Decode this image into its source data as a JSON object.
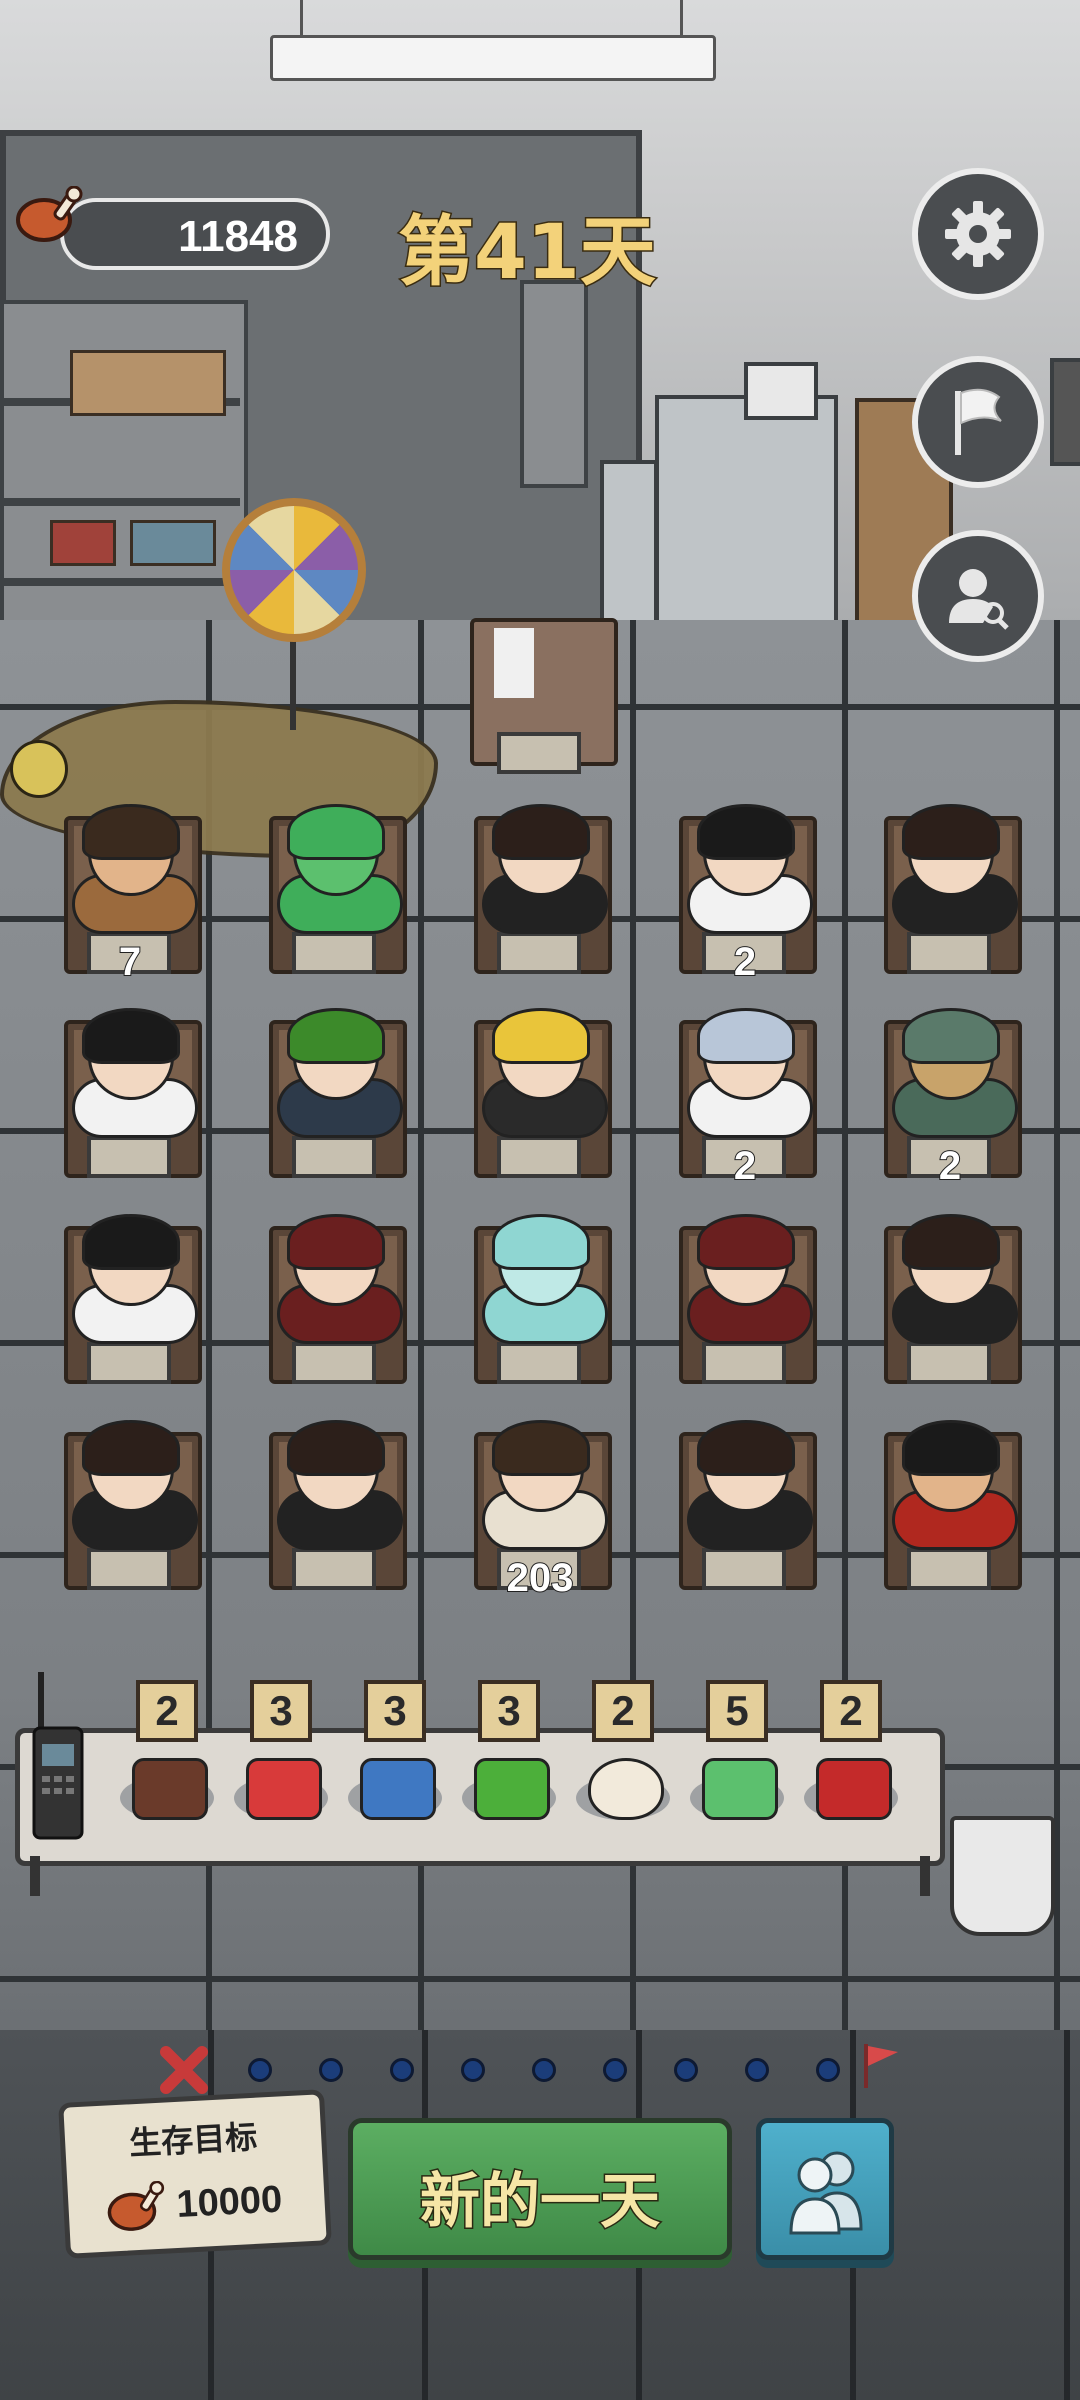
{
  "hud": {
    "food_count": "11848",
    "day_label": "第41天",
    "food_icon": "meat-icon"
  },
  "side_buttons": [
    {
      "name": "settings",
      "icon": "gear-icon"
    },
    {
      "name": "surrender",
      "icon": "white-flag-icon"
    },
    {
      "name": "search-person",
      "icon": "person-search-icon"
    }
  ],
  "grid": {
    "rows": [
      [
        {
          "char": "bearded-man",
          "count": "7",
          "hair": "#3a2a1e",
          "body": "#9b6a3d",
          "skin": "#e2b48a"
        },
        {
          "char": "frog-creature",
          "count": "",
          "hair": "#3fae5a",
          "body": "#3fae5a",
          "skin": "#5cc06e"
        },
        {
          "char": "ponytail-girl",
          "count": "",
          "hair": "#2c1f1a",
          "body": "#222222",
          "skin": "#f2d8c2"
        },
        {
          "char": "masked-kid",
          "count": "2",
          "hair": "#1a1a1a",
          "body": "#f2f2f2",
          "skin": "#f2d8c2"
        },
        {
          "char": "ponytail-girl",
          "count": "",
          "hair": "#2c1f1a",
          "body": "#222222",
          "skin": "#f2d8c2"
        }
      ],
      [
        {
          "char": "black-hair-boy",
          "count": "",
          "hair": "#1a1a1a",
          "body": "#f2f2f2",
          "skin": "#f2d8c2"
        },
        {
          "char": "watermelon-head",
          "count": "",
          "hair": "#3c8a2a",
          "body": "#2d3a4a",
          "skin": "#f2d8c2"
        },
        {
          "char": "blonde-vampire",
          "count": "",
          "hair": "#e9c53a",
          "body": "#2a2a2a",
          "skin": "#f2d8c2"
        },
        {
          "char": "silver-hair-girl",
          "count": "2",
          "hair": "#b8c6d8",
          "body": "#f2f2f2",
          "skin": "#f2d8c2"
        },
        {
          "char": "robot",
          "count": "2",
          "hair": "#5a7a6a",
          "body": "#4a6a5a",
          "skin": "#c8a36a"
        }
      ],
      [
        {
          "char": "smiling-girl",
          "count": "",
          "hair": "#1a1a1a",
          "body": "#f2f2f2",
          "skin": "#f2d8c2"
        },
        {
          "char": "red-hood-glasses",
          "count": "",
          "hair": "#6a1f1f",
          "body": "#6a1f1f",
          "skin": "#f2d8c2"
        },
        {
          "char": "cyan-fox",
          "count": "",
          "hair": "#8fd6d2",
          "body": "#8fd6d2",
          "skin": "#bfe9e6"
        },
        {
          "char": "red-hood-glasses",
          "count": "",
          "hair": "#6a1f1f",
          "body": "#6a1f1f",
          "skin": "#f2d8c2"
        },
        {
          "char": "ponytail-girl",
          "count": "",
          "hair": "#2c1f1a",
          "body": "#222222",
          "skin": "#f2d8c2"
        }
      ],
      [
        {
          "char": "ponytail-girl",
          "count": "",
          "hair": "#2c1f1a",
          "body": "#222222",
          "skin": "#f2d8c2"
        },
        {
          "char": "ponytail-girl",
          "count": "",
          "hair": "#2c1f1a",
          "body": "#222222",
          "skin": "#f2d8c2"
        },
        {
          "char": "ancient-scholar",
          "count": "203",
          "hair": "#3a2a1e",
          "body": "#e8e0d0",
          "skin": "#f2d8c2"
        },
        {
          "char": "ponytail-girl",
          "count": "",
          "hair": "#2c1f1a",
          "body": "#222222",
          "skin": "#f2d8c2"
        },
        {
          "char": "sunglasses-man",
          "count": "",
          "hair": "#1a1a1a",
          "body": "#b0281f",
          "skin": "#e2b48a"
        }
      ]
    ]
  },
  "items": [
    {
      "count": "2",
      "icon": "mushroom-plate-icon",
      "color": "#6a3a2a"
    },
    {
      "count": "3",
      "icon": "watermelon-icon",
      "color": "#d83a3a"
    },
    {
      "count": "3",
      "icon": "clothing-icon",
      "color": "#3f78c2"
    },
    {
      "count": "3",
      "icon": "herb-icon",
      "color": "#4caf3a"
    },
    {
      "count": "2",
      "icon": "egg-icon",
      "color": "#f2eadb"
    },
    {
      "count": "5",
      "icon": "frog-icon",
      "color": "#5cc06e"
    },
    {
      "count": "2",
      "icon": "raw-meat-icon",
      "color": "#c42a2a"
    }
  ],
  "progress": {
    "start_icon": "red-x-icon",
    "end_icon": "red-flag-icon",
    "dots": 9
  },
  "goal": {
    "label": "生存目标",
    "value": "10000"
  },
  "buttons": {
    "new_day": "新的一天",
    "people_icon": "people-icon"
  },
  "colors": {
    "accent_gold": "#f3d27a",
    "new_day_green": "#4f9c56",
    "people_blue": "#45a0bb"
  }
}
